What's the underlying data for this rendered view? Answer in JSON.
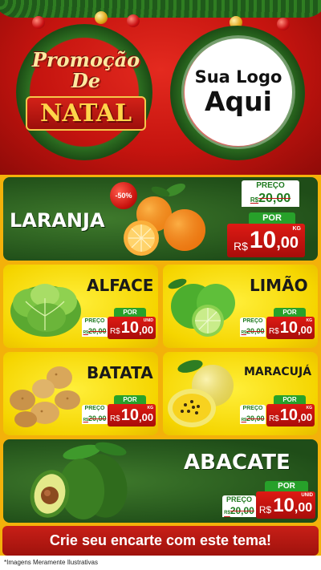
{
  "header": {
    "promo_top": "Promoção De",
    "promo_natal": "NATAL",
    "logo_line1": "Sua Logo",
    "logo_line2": "Aqui"
  },
  "colors": {
    "header_red": "#c5140f",
    "card_green": "#1f4d18",
    "card_yellow": "#f5d500",
    "price_red": "#c41414",
    "por_green": "#27a12a"
  },
  "products": {
    "laranja": {
      "name": "LARANJA",
      "discount": "-50%",
      "price_label": "PREÇO",
      "old_price": "20,00",
      "old_currency": "R$",
      "por_label": "POR",
      "currency": "R$",
      "price_int": "10",
      "price_dec": ",00",
      "unit": "KG",
      "icon": "orange-icon"
    },
    "alface": {
      "name": "ALFACE",
      "price_label": "PREÇO",
      "old_price": "20,00",
      "old_currency": "R$",
      "por_label": "POR",
      "currency": "R$",
      "price_int": "10",
      "price_dec": ",00",
      "unit": "UNID",
      "icon": "lettuce-icon"
    },
    "limao": {
      "name": "LIMÃO",
      "price_label": "PREÇO",
      "old_price": "20,00",
      "old_currency": "R$",
      "por_label": "POR",
      "currency": "R$",
      "price_int": "10",
      "price_dec": ",00",
      "unit": "KG",
      "icon": "lime-icon"
    },
    "batata": {
      "name": "BATATA",
      "price_label": "PREÇO",
      "old_price": "20,00",
      "old_currency": "R$",
      "por_label": "POR",
      "currency": "R$",
      "price_int": "10",
      "price_dec": ",00",
      "unit": "KG",
      "icon": "potato-icon"
    },
    "maracuja": {
      "name": "MARACUJÁ",
      "price_label": "PREÇO",
      "old_price": "20,00",
      "old_currency": "R$",
      "por_label": "POR",
      "currency": "R$",
      "price_int": "10",
      "price_dec": ",00",
      "unit": "KG",
      "icon": "passion-fruit-icon"
    },
    "abacate": {
      "name": "ABACATE",
      "price_label": "PREÇO",
      "old_price": "20,00",
      "old_currency": "R$",
      "por_label": "POR",
      "currency": "R$",
      "price_int": "10",
      "price_dec": ",00",
      "unit": "UNID",
      "icon": "avocado-icon"
    }
  },
  "footer": {
    "cta": "Crie seu encarte com este tema!",
    "note": "*Imagens Meramente Ilustrativas"
  }
}
